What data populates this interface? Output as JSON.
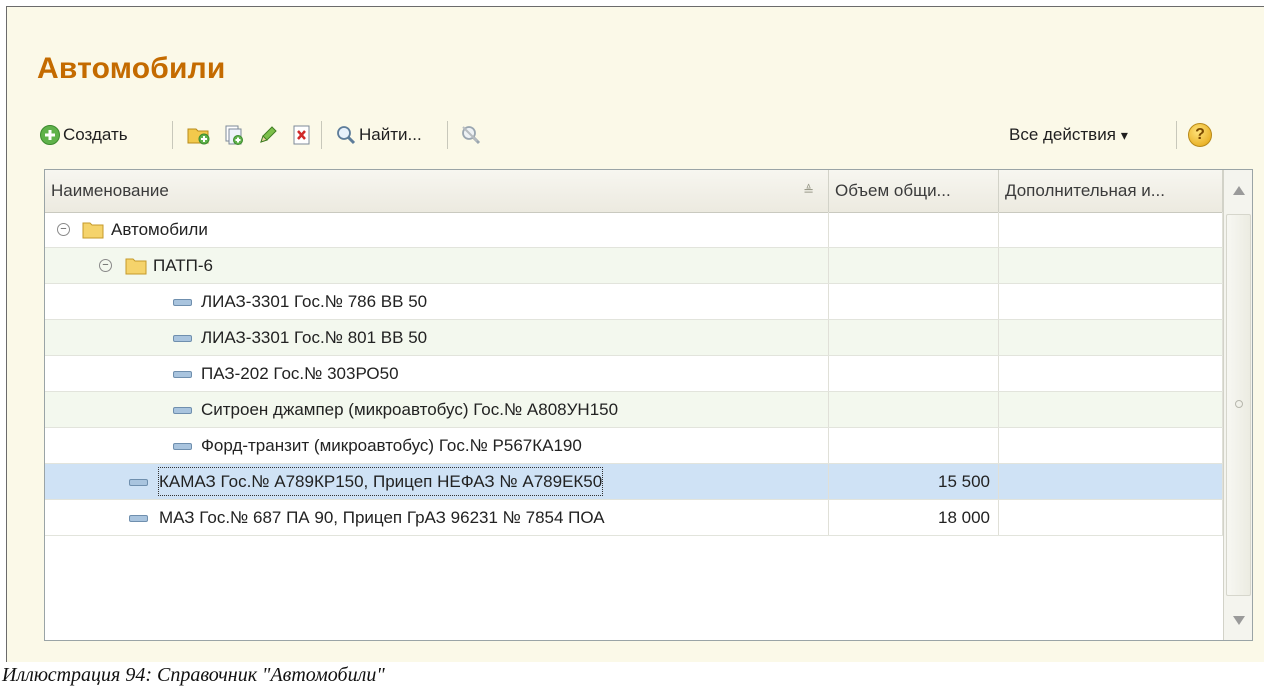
{
  "window": {
    "title": "Автомобили"
  },
  "toolbar": {
    "create_label": "Создать",
    "find_label": "Найти...",
    "all_actions_label": "Все действия",
    "all_actions_arrow": "▾",
    "help_glyph": "?",
    "icons": [
      "plus-circle-icon",
      "add-folder-icon",
      "copy-icon",
      "pencil-icon",
      "delete-icon",
      "magnifier-icon",
      "cancel-search-icon",
      "help-icon"
    ]
  },
  "table": {
    "columns": [
      "Наименование",
      "Объем общи...",
      "Дополнительная и..."
    ],
    "rows": [
      {
        "name": "Автомобили",
        "volume": "",
        "extra": ""
      },
      {
        "name": "ПАТП-6",
        "volume": "",
        "extra": ""
      },
      {
        "name": "ЛИАЗ-3301 Гос.№ 786 ВВ 50",
        "volume": "",
        "extra": ""
      },
      {
        "name": "ЛИАЗ-3301 Гос.№ 801 ВВ 50",
        "volume": "",
        "extra": ""
      },
      {
        "name": "ПАЗ-202 Гос.№ 303РО50",
        "volume": "",
        "extra": ""
      },
      {
        "name": "Ситроен джампер (микроавтобус) Гос.№ А808УН150",
        "volume": "",
        "extra": ""
      },
      {
        "name": "Форд-транзит (микроавтобус) Гос.№ Р567КА190",
        "volume": "",
        "extra": ""
      },
      {
        "name": "КАМАЗ Гос.№ А789КР150, Прицеп НЕФАЗ № А789ЕК50",
        "volume": "15 500",
        "extra": ""
      },
      {
        "name": "МАЗ Гос.№ 687 ПА 90, Прицеп ГрАЗ 96231 № 7854 ПОА",
        "volume": "18 000",
        "extra": ""
      }
    ]
  },
  "caption": "Иллюстрация 94: Справочник \"Автомобили\"",
  "colors": {
    "title": "#c46b00",
    "background": "#fbf9e8",
    "selected_row": "#cfe2f5",
    "alt_row": "#f3f8ee"
  }
}
